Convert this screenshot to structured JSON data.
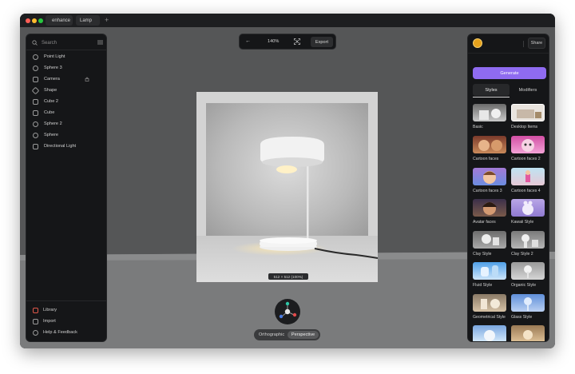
{
  "tabs": {
    "app_name": "enhance",
    "file_name": "Lamp"
  },
  "left_panel": {
    "search_placeholder": "Search",
    "layers": [
      {
        "label": "Point Light",
        "icon": "point-light-icon"
      },
      {
        "label": "Sphere 3",
        "icon": "sphere-icon"
      },
      {
        "label": "Camera",
        "icon": "camera-icon"
      },
      {
        "label": "Shape",
        "icon": "shape-icon"
      },
      {
        "label": "Cube 2",
        "icon": "cube-icon"
      },
      {
        "label": "Cube",
        "icon": "cube-icon"
      },
      {
        "label": "Sphere 2",
        "icon": "sphere-icon"
      },
      {
        "label": "Sphere",
        "icon": "sphere-icon"
      },
      {
        "label": "Directional Light",
        "icon": "directional-light-icon"
      }
    ],
    "footer": [
      {
        "label": "Library",
        "icon": "library-icon"
      },
      {
        "label": "Import",
        "icon": "import-icon"
      },
      {
        "label": "Help & Feedback",
        "icon": "help-icon"
      }
    ]
  },
  "toolbar": {
    "zoom": "140%",
    "export_label": "Export"
  },
  "viewport": {
    "resolution_label": "512 × 512 (100%)",
    "view_modes": [
      "Orthographic",
      "Perspective"
    ],
    "active_view": "Perspective"
  },
  "right_panel": {
    "share_label": "Share",
    "generate_label": "Generate",
    "tabs": [
      "Styles",
      "Modifiers"
    ],
    "active_tab": "Styles",
    "accent_color": "#8f6bf0",
    "styles": [
      {
        "label": "Basic"
      },
      {
        "label": "Desktop Items"
      },
      {
        "label": "Cartoon faces"
      },
      {
        "label": "Cartoon faces 2"
      },
      {
        "label": "Cartoon faces 3"
      },
      {
        "label": "Cartoon faces 4"
      },
      {
        "label": "Avatar faces"
      },
      {
        "label": "Kawaii Style"
      },
      {
        "label": "Clay Style"
      },
      {
        "label": "Clay Style 2"
      },
      {
        "label": "Fluid Style"
      },
      {
        "label": "Organic Style"
      },
      {
        "label": "Geometrical Style"
      },
      {
        "label": "Glass Style"
      },
      {
        "label": ""
      },
      {
        "label": ""
      }
    ]
  }
}
